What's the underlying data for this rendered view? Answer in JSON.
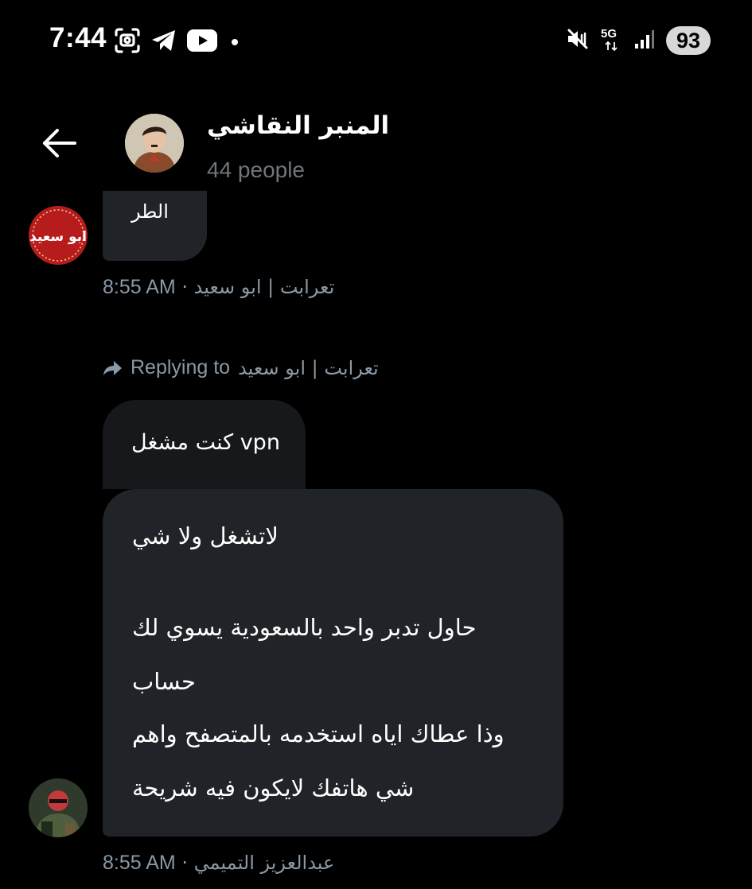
{
  "status_bar": {
    "time": "7:44",
    "battery": "93",
    "network": "5G",
    "icons": [
      "screenshot-icon",
      "telegram-icon",
      "youtube-icon",
      "mute-icon",
      "signal-icon"
    ]
  },
  "header": {
    "group_name": "المنبر النقاشي",
    "member_count": "44 people"
  },
  "messages": [
    {
      "text": "الطر",
      "sender": "تعرابت | ابو سعيد",
      "time": "8:55 AM"
    },
    {
      "reply_prefix": "Replying to",
      "reply_to": "تعرابت | ابو سعيد",
      "text": "كنت مشغل vpn"
    },
    {
      "lines": [
        "لاتشغل ولا شي",
        "حاول تدبر واحد بالسعودية يسوي لك",
        "حساب",
        "وذا عطاك اياه استخدمه بالمتصفح واهم",
        "شي هاتفك لايكون فيه شريحة"
      ],
      "sender": "عبدالعزيز التميمي",
      "time": "8:55 AM"
    }
  ],
  "avatar_badge_text": "ابو سعيد",
  "colors": {
    "background": "#000000",
    "bubble": "#202327",
    "meta_text": "#8b98a5",
    "secondary_text": "#71767b"
  }
}
